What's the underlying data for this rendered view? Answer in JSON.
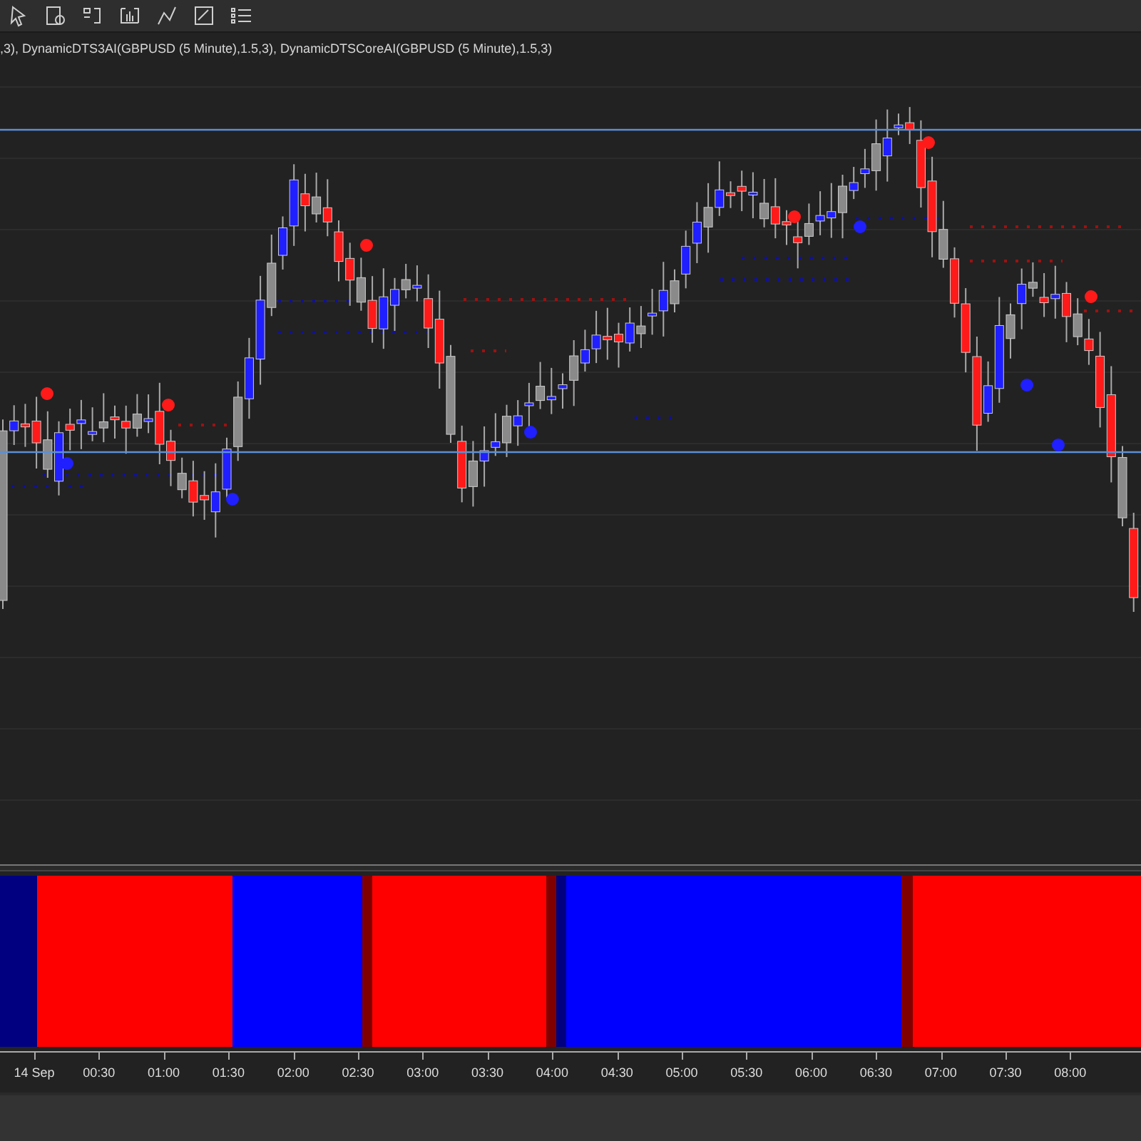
{
  "indicator_label": ",3), DynamicDTS3AI(GBPUSD (5 Minute),1.5,3), DynamicDTSCoreAI(GBPUSD (5 Minute),1.5,3)",
  "time_axis": [
    "14 Sep",
    "00:30",
    "01:00",
    "01:30",
    "02:00",
    "02:30",
    "03:00",
    "03:30",
    "04:00",
    "04:30",
    "05:00",
    "05:30",
    "06:00",
    "06:30",
    "07:00",
    "07:30",
    "08:00"
  ]
}
